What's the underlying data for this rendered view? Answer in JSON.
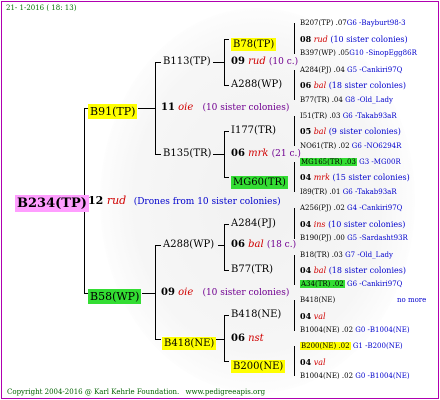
{
  "header": "21- 1-2016 ( 18: 13)",
  "copyright": "Copyright 2004-2016 @ Karl Kehrle Foundation.",
  "website": "www.pedigreeapis.org",
  "root": {
    "id": "B234(TP)",
    "year": "12",
    "line": "rud",
    "desc": "(Drones from 10 sister colonies)"
  },
  "g1": [
    {
      "id": "B91(TP)",
      "year": "11",
      "line": "oie",
      "desc": "(10 sister colonies)"
    },
    {
      "id": "B58(WP)",
      "year": "09",
      "line": "oie",
      "desc": "(10 sister colonies)"
    }
  ],
  "g2": [
    {
      "id": "B113(TP)",
      "year": "09",
      "line": "rud",
      "desc": "(10 c.)"
    },
    {
      "id": "B135(TR)",
      "year": "06",
      "line": "mrk",
      "desc": "(21 c.)"
    },
    {
      "id": "A288(WP)",
      "year": "06",
      "line": "bal",
      "desc": "(18 c.)"
    },
    {
      "id": "B418(NE)",
      "year": "06",
      "line": "nst",
      "desc": ""
    }
  ],
  "g3": [
    {
      "id": "B78(TP)",
      "year": "08",
      "line": "rud",
      "desc": "(10 sister colonies)"
    },
    {
      "id": "A288(WP)",
      "year": "06",
      "line": "bal",
      "desc": "(18 sister colonies)"
    },
    {
      "id": "I177(TR)",
      "year": "05",
      "line": "bal",
      "desc": "(9 sister colonies)"
    },
    {
      "id": "MG60(TR)",
      "year": "04",
      "line": "mrk",
      "desc": "(15 sister colonies)"
    },
    {
      "id": "A284(PJ)",
      "year": "04",
      "line": "ins",
      "desc": "(10 sister colonies)"
    },
    {
      "id": "B77(TR)",
      "year": "04",
      "line": "bal",
      "desc": "(18 sister colonies)"
    },
    {
      "id": "B418(NE)",
      "year": "04",
      "line": "val",
      "desc": ""
    },
    {
      "id": "B200(NE)",
      "year": "04",
      "line": "val",
      "desc": ""
    }
  ],
  "g4": [
    {
      "id": "B207(TP)",
      "yr": ".07",
      "code": "G6",
      "name": "-Bayburt98-3"
    },
    {
      "id": "B397(WP)",
      "yr": ".05",
      "code": "G10",
      "name": "-SinopEgg86R"
    },
    {
      "id": "A284(PJ)",
      "yr": ".04",
      "code": "G5",
      "name": "-Cankiri97Q"
    },
    {
      "id": "B77(TR)",
      "yr": ".04",
      "code": "G8",
      "name": "-Old_Lady"
    },
    {
      "id": "I51(TR)",
      "yr": ".03",
      "code": "G6",
      "name": "-Takab93aR"
    },
    {
      "id": "NO61(TR)",
      "yr": ".02",
      "code": "G6",
      "name": "-NO6294R"
    },
    {
      "id": "MG165(TR)",
      "yr": ".03",
      "code": "G3",
      "name": "-MG00R"
    },
    {
      "id": "I89(TR)",
      "yr": ".01",
      "code": "G6",
      "name": "-Takab93aR"
    },
    {
      "id": "A256(PJ)",
      "yr": ".02",
      "code": "G4",
      "name": "-Cankiri97Q"
    },
    {
      "id": "B190(PJ)",
      "yr": ".00",
      "code": "G5",
      "name": "-Sardasht93R"
    },
    {
      "id": "B18(TR)",
      "yr": ".03",
      "code": "G7",
      "name": "-Old_Lady"
    },
    {
      "id": "A34(TR)",
      "yr": ".02",
      "code": "G6",
      "name": "-Cankiri97Q"
    },
    {
      "id": "B418(NE)",
      "yr": "",
      "code": "",
      "name": "no more"
    },
    {
      "id": "B1004(NE)",
      "yr": ".02",
      "code": "G0",
      "name": "-B1004(NE)"
    },
    {
      "id": "B200(NE)",
      "yr": ".02",
      "code": "G1",
      "name": "-B200(NE)"
    },
    {
      "id": "B1004(NE)",
      "yr": ".02",
      "code": "G0",
      "name": "-B1004(NE)"
    }
  ]
}
